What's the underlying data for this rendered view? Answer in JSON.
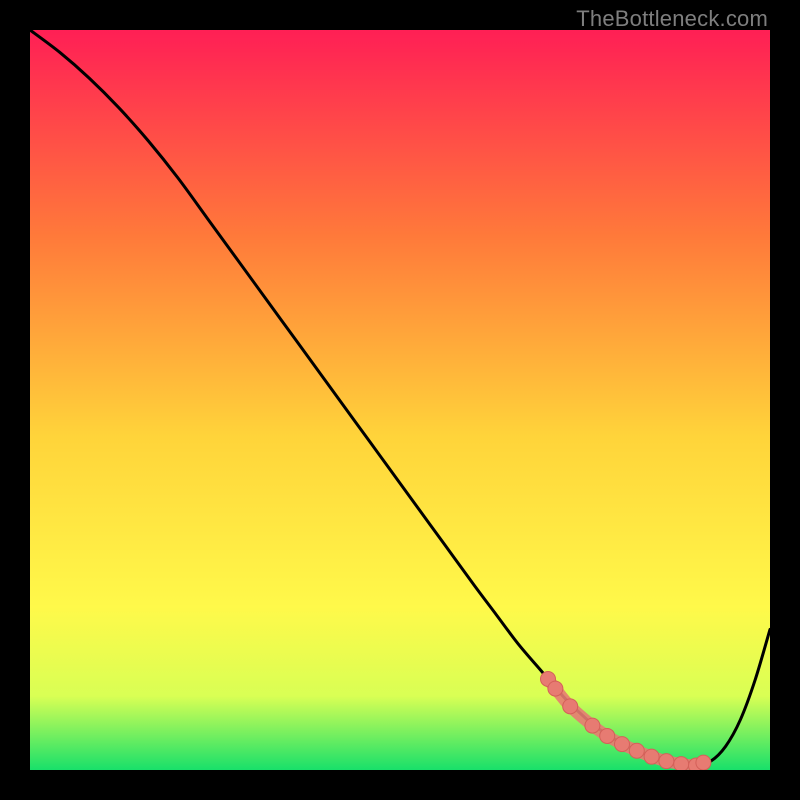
{
  "watermark": "TheBottleneck.com",
  "colors": {
    "gradient_top": "#ff1f55",
    "gradient_mid1": "#ff7a3a",
    "gradient_mid2": "#ffd43a",
    "gradient_mid3": "#fff94a",
    "gradient_mid4": "#d9ff54",
    "gradient_bottom": "#18e06a",
    "curve": "#000000",
    "marker_fill": "#e77b72",
    "marker_stroke": "#d46059"
  },
  "chart_data": {
    "type": "line",
    "title": "",
    "xlabel": "",
    "ylabel": "",
    "xlim": [
      0,
      100
    ],
    "ylim": [
      0,
      100
    ],
    "series": [
      {
        "name": "bottleneck-curve",
        "x": [
          0,
          4,
          8,
          12,
          16,
          20,
          24,
          28,
          32,
          36,
          40,
          44,
          48,
          52,
          56,
          60,
          63,
          66,
          69,
          72,
          74,
          76,
          78,
          80,
          82,
          84,
          86,
          88,
          90,
          92,
          94,
          96,
          98,
          100
        ],
        "y": [
          100,
          97,
          93.5,
          89.5,
          85,
          80,
          74.5,
          69,
          63.5,
          58,
          52.5,
          47,
          41.5,
          36,
          30.5,
          25,
          21,
          17,
          13.5,
          10,
          8,
          6.2,
          4.8,
          3.6,
          2.6,
          1.8,
          1.2,
          0.8,
          0.6,
          1.2,
          3.2,
          6.8,
          12.2,
          19
        ]
      }
    ],
    "markers": {
      "name": "highlight-points",
      "x": [
        70,
        71,
        73,
        76,
        78,
        80,
        82,
        84,
        86,
        88,
        90,
        91
      ],
      "y": [
        12.3,
        11.0,
        8.6,
        6.0,
        4.6,
        3.5,
        2.6,
        1.8,
        1.2,
        0.8,
        0.6,
        1.0
      ]
    }
  }
}
